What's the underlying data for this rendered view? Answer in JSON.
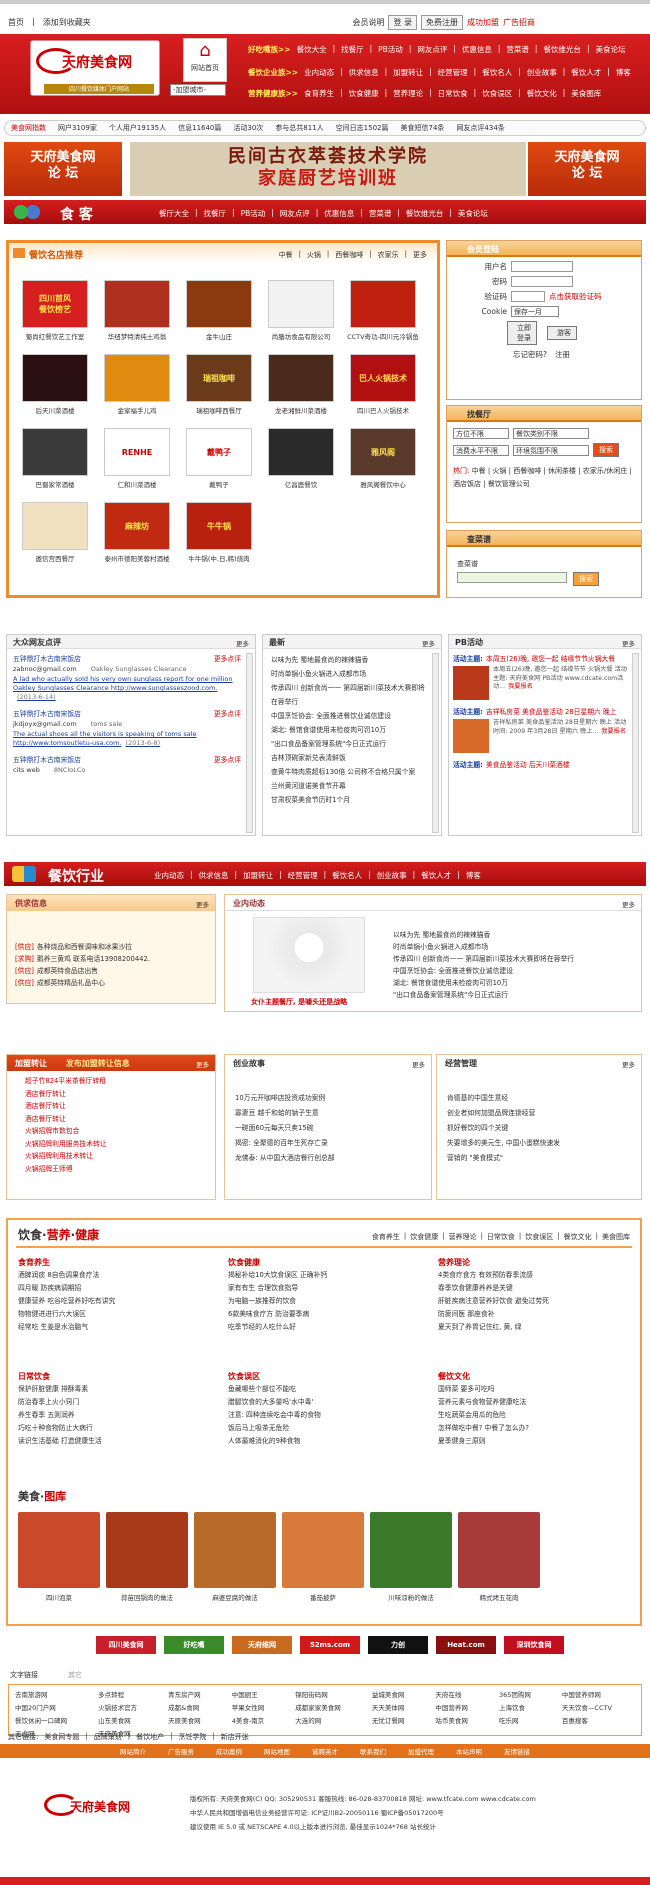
{
  "topbar": {
    "home": "首页",
    "favorite": "添加到收藏夹",
    "help": "会员说明",
    "login": "登 录",
    "register": "免费注册",
    "join": "成功加盟",
    "ads": "广告招商"
  },
  "header": {
    "logo": "天府美食网",
    "slogan": "四川餐饮媒体门户网站",
    "site_home": "网站首页",
    "city_select": "-加盟城市-",
    "row1_label": "好吃嘴族>>",
    "row1": [
      "餐饮大全",
      "找餐厅",
      "PB活动",
      "网友点评",
      "优惠信息",
      "营菜谱",
      "餐饮维光台",
      "美食论坛"
    ],
    "row2_label": "餐饮企业族>>",
    "row2": [
      "业内动态",
      "供求信息",
      "加盟转让",
      "经营管理",
      "餐饮名人",
      "创业故事",
      "餐饮人才",
      "博客"
    ],
    "row3_label": "营养健康族>>",
    "row3": [
      "食育养生",
      "饮食健康",
      "营养理论",
      "日常饮食",
      "饮食误区",
      "餐饮文化",
      "美食图库"
    ]
  },
  "stats": {
    "label": "美食网指数",
    "items": [
      "网户3109家",
      "个人用户19135人",
      "信息11640篇",
      "活动30次",
      "参与总共811人",
      "空间日志1502篇",
      "美食短信74条",
      "网友点评434条"
    ]
  },
  "banner": {
    "left": "天府美食网\n论 坛",
    "mid1": "民间古衣萃荟技术学院",
    "mid2": "家庭厨艺培训班",
    "right": "天府美食网\n论 坛"
  },
  "catband": {
    "title": "食 客",
    "links": [
      "餐厅大全",
      "找餐厅",
      "PB活动",
      "网友点评",
      "优惠信息",
      "营菜谱",
      "餐饮维光台",
      "美食论坛"
    ]
  },
  "restaurants": {
    "title": "餐饮名店推荐",
    "tabs": [
      "中餐",
      "火锅",
      "西餐咖啡",
      "农家乐",
      "更多"
    ],
    "items": [
      {
        "name": "蜀尚红餐饮艺工作室",
        "color": "#d62020",
        "sub": "四川首风\n餐饮榜艺"
      },
      {
        "name": "华纽梦特清纯土鸡翁",
        "color": "#b03020",
        "sub": ""
      },
      {
        "name": "金牛山庄",
        "color": "#8b3a10",
        "sub": ""
      },
      {
        "name": "尚膳坊食品有限公司",
        "color": "#f2f2f2",
        "sub": ""
      },
      {
        "name": "CCTV奇功-四川元冷锅鱼",
        "color": "#c02010",
        "sub": ""
      },
      {
        "name": "后天川菜酒楼",
        "color": "#2a1010",
        "sub": ""
      },
      {
        "name": "金家福手儿鸡",
        "color": "#e08a10",
        "sub": ""
      },
      {
        "name": "瑞祖咖啡西餐厅",
        "color": "#6a3a1a",
        "sub": "瑞祖咖啡"
      },
      {
        "name": "龙老湘鲜川菜酒楼",
        "color": "#4a2a1a",
        "sub": ""
      },
      {
        "name": "四川巴人火锅技术",
        "color": "#b01010",
        "sub": "巴人火锅技术"
      },
      {
        "name": "巴蜀家常酒楼",
        "color": "#3a3a3a",
        "sub": ""
      },
      {
        "name": "仁和川菜酒楼",
        "color": "#ffffff",
        "sub": "RENHE"
      },
      {
        "name": "戴鸭子",
        "color": "#ffffff",
        "sub": "戴鸭子"
      },
      {
        "name": "亿昌鹿餐饮",
        "color": "#2a2a2a",
        "sub": ""
      },
      {
        "name": "雅风阁餐饮中心",
        "color": "#5a3a2a",
        "sub": "雅风阁"
      },
      {
        "name": "邀信宫西餐厅",
        "color": "#f0e0c0",
        "sub": ""
      },
      {
        "name": "泰州市德阳美蓉村酒楼",
        "color": "#c02a10",
        "sub": "麻辣坊"
      },
      {
        "name": "牛牛锅(中,日,韩)烧肉",
        "color": "#b82010",
        "sub": "牛牛锅"
      }
    ]
  },
  "login": {
    "title": "会员登陆",
    "user": "用户名",
    "pass": "密码",
    "code": "验证码",
    "code_link": "点击获取验证码",
    "cookie": "Cookie",
    "cookie_val": "保存一月",
    "login_btn": "立即登录",
    "register_btn": "游客",
    "forget": "忘记密码?",
    "reg": "注册"
  },
  "finder": {
    "title": "找餐厅",
    "s1": "方位不限",
    "s2": "餐饮类别不限",
    "s3": "消费水平不限",
    "s4": "环境氛围不限",
    "search": "搜索",
    "hot_label": "热门:",
    "hot": [
      "中餐",
      "火锅",
      "西餐咖啡",
      "休闲茶楼",
      "农家乐/休闲庄",
      "酒店饭店",
      "餐饮管理公司"
    ]
  },
  "recipe": {
    "title": "查菜谱",
    "label": "查菜谱",
    "btn": "搜索"
  },
  "reviews": {
    "title": "大众网友点评",
    "more": "更多",
    "items": [
      {
        "shop": "五钟鼎打木古南宋饭店",
        "user": "zabnoc@gmail.com",
        "topic": "Oakley Sunglasses Clearance",
        "content": "A lad who actually sold his very own sunglass report for one million Oakley Sunglasses Clearance http://www.sunglasseszood.com.",
        "date": "(2013-6-14)"
      },
      {
        "shop": "五钟鼎打木古南宋饭店",
        "user": "jkdjoyx@gmail.com",
        "topic": "toms sale",
        "content": "The actual shoes all the visitors is speaking of toms sale http://www.tomsoutletu-usa.com.",
        "date": "(2013-6-8)"
      },
      {
        "shop": "五钟鼎打木古南宋饭店",
        "user": "cits web",
        "topic": "8NCIoLCo",
        "content": "",
        "date": ""
      }
    ],
    "more_label": "更多点评"
  },
  "latest": {
    "title": "最新",
    "more": "更多",
    "items": [
      "以味为先 蜀地最食尚的辣辣猫香",
      "时尚单锅小鱼火锅进入成都市场",
      "传承四川 创新食尚一一 第四届新川菜技术大赛即将在蓉举行",
      "中国烹饪协会: 全面推进餐饮业诚信建设",
      "湖北: 餐馆食谱使用未检疫肉可罚10万",
      "\"出口食品备案管理系统\"今日正式运行",
      "吉林顶碗家新兑表清鲜饭",
      "查黄牛特肉质超标130倍 公司称不合格只属个案",
      "兰州黄河道诺美食节开幕",
      "甘肃权菜美食节历时1个月"
    ]
  },
  "pb": {
    "title": "PB活动",
    "more": "更多",
    "items": [
      {
        "head": "活动主题:",
        "title": "本周五(26)晚, 邀您一起 结缘节节火锅大餐",
        "text": "本周五(26)晚, 邀您一起 结缘节节 火锅大餐 活动主题: 天府美食网 PB活动 www.cdcate.com活动...",
        "link": "我要报名"
      },
      {
        "head": "活动主题:",
        "title": "吉祥私房菜 美食品鉴活动 28日星期六 晚上",
        "text": "吉祥私房菜 美食品鉴活动 28日星期六 晚上 活动时间: 2009 年3月28日 星期六 晚上...",
        "link": "我要报名"
      },
      {
        "head": "活动主题:",
        "title": "美食品鉴活动 后天川菜酒楼",
        "text": "",
        "link": ""
      }
    ]
  },
  "industry": {
    "title": "餐饮行业",
    "links": [
      "业内动态",
      "供求信息",
      "加盟转让",
      "经营管理",
      "餐饮名人",
      "创业故事",
      "餐饮人才",
      "博客"
    ]
  },
  "supply": {
    "title": "供求信息",
    "more": "更多",
    "items": [
      {
        "tag": "[供应]",
        "text": "各种烧品和西餐调味和冰果沙拉"
      },
      {
        "tag": "[求购]",
        "text": "鹅养三黄鸡 联系电话13908200442."
      },
      {
        "tag": "[供应]",
        "text": "成都英特食品店出售"
      },
      {
        "tag": "[供应]",
        "text": "成都英特精品礼品中心"
      }
    ]
  },
  "news": {
    "title": "业内动态",
    "more": "更多",
    "caption": "女仆主题餐厅, 是噱头还是战略",
    "items": [
      "以味为先 蜀地最食尚的辣辣猫香",
      "时尚单锅小鱼火锅进入成都市场",
      "传承四川 创新食尚一一 第四届新川菜技术大赛即将在蓉举行",
      "中国烹饪协会: 全面推进餐饮业诚信建设",
      "湖北: 餐馆食谱使用未检疫肉可罚10万",
      "\"出口食品备案管理系统\"今日正式运行"
    ]
  },
  "transfer": {
    "title": "加盟转让",
    "sub": "发布加盟转让信息",
    "more": "更多",
    "items": [
      "超子竹824平米茶餐厅转租",
      "酒店餐厅转让",
      "酒店餐厅转让",
      "酒店餐厅转让",
      "火锅招牌市数包合",
      "火锅招牌利用服务技术转让",
      "火锅招牌利用技术转让",
      "火锅招牌王师傅"
    ]
  },
  "story": {
    "title": "创业故事",
    "more": "更多",
    "items": [
      "10万元开咖啡店投资成功案例",
      "寡妻豆 越千和蛤的钠子生意",
      "一碗面60元每天只卖15碗",
      "揭密: 全聚德的百年生死存亡录",
      "龙佛泰: 从中国大酒店餐行创总部"
    ]
  },
  "mgmt": {
    "title": "经营管理",
    "more": "更多",
    "items": [
      "肯德基的中国生意经",
      "创业者如何加盟品牌连锁经营",
      "抓好餐饮的四个关键",
      "失要增多的美元生, 中国小蛋糕快速发",
      "营销的 \"美食模式\""
    ]
  },
  "food": {
    "title1": "饮食",
    "title2": "营养",
    "title3": "健康",
    "nav": [
      "食育养生",
      "饮食健康",
      "营养理论",
      "日常饮食",
      "饮食误区",
      "餐饮文化",
      "美食图库"
    ],
    "cols": [
      {
        "title": "食育养生",
        "items": [
          "酒脾润痰 8自色调果食疗法",
          "四月暖 防疾病调期招",
          "健康营养 吃谷吃营养好吃有讲究",
          "物物健进进行六大误区",
          "经常吃 生姜是水治脑气"
        ]
      },
      {
        "title": "饮食健康",
        "items": [
          "揭秘补给10大饮食误区 正确补钙",
          "家有有生 合理饮食指导",
          "为电脑一族推荐的饮食",
          "6款美味食疗方 防治要季病",
          "吃季节经的人吃什么好"
        ]
      },
      {
        "title": "营养理论",
        "items": [
          "4类食疗食方 有效预防春季流感",
          "春季饮食健康养养是关键",
          "肝脏疾病注意营养好饮食 避免过劳死",
          "防疲间医 那座食补",
          "夏天到了养胃记住红, 黄, 绿"
        ]
      },
      {
        "title": "日常饮食",
        "items": [
          "保护肝脏健康 排酥毒素",
          "防治春季上火小窍门",
          "养生春季 五则润养",
          "巧吃十种食物防止大病行",
          "读识生活基础 打造健康生活"
        ]
      },
      {
        "title": "饮食误区",
        "items": [
          "鱼藏哪些个部位不能吃",
          "腊腿饮食的大多量吗'水中毒'",
          "注意: 四种连续吃会中毒的食物",
          "饭后马上吸茶无危险",
          "人体最难消化的9种食物"
        ]
      },
      {
        "title": "餐饮文化",
        "items": [
          "国师菜 要多可吃吗",
          "营养元素与食物营养健康吃法",
          "生吃蔬菜会用瓜的危险",
          "怎样做吃中餐? 中餐了怎么办?",
          "夏季健身三原则"
        ]
      }
    ],
    "gallery_title1": "美食",
    "gallery_title2": "图库",
    "gallery": [
      {
        "name": "四川泡菜",
        "color": "#c84a2a"
      },
      {
        "name": "蒜苗回锅肉的做法",
        "color": "#a83a1a"
      },
      {
        "name": "麻婆豆腐的做法",
        "color": "#b86a2a"
      },
      {
        "name": "番茄披萨",
        "color": "#d87a3a"
      },
      {
        "name": "川味凉粉的做法",
        "color": "#3a7a2a"
      },
      {
        "name": "韩式烤五花肉",
        "color": "#a83a3a"
      }
    ]
  },
  "partners": [
    {
      "name": "四川美食网",
      "color": "#c8202a"
    },
    {
      "name": "好吃嘴",
      "color": "#3a8a2a"
    },
    {
      "name": "天府维网",
      "color": "#c86a20"
    },
    {
      "name": "52ms.com",
      "color": "#d01a1a"
    },
    {
      "name": "力创",
      "color": "#111111"
    },
    {
      "name": "Heat.com",
      "color": "#8a1010"
    },
    {
      "name": "深圳饮食网",
      "color": "#c01020"
    }
  ],
  "links": {
    "tab1": "文字链接",
    "tab2": "其它",
    "items": [
      "去南旅游网",
      "多点转程",
      "青东房产网",
      "中国厨王",
      "锦阳街码网",
      "益城美食网",
      "天府在线",
      "365团购网",
      "中国营养师网",
      "中国20门户网",
      "火锅技术官方",
      "成都&食网",
      "苹果女性网",
      "成都家家美食网",
      "天天美体网",
      "中国营养网",
      "上海饮食",
      "天天饮食—CCTV",
      "餐饮休闲一口碑网",
      "山东美食网",
      "天原美食网",
      "4美食-南京",
      "大连的网",
      "无忧订餐网",
      "咕币美食网",
      "吃乐网",
      "百惠搜客",
      "无虑网",
      "天府美食网"
    ]
  },
  "other": {
    "label": "其它链接:",
    "items": [
      "美食网专题",
      "品牌策划",
      "餐饮地产",
      "烹饪学院",
      "新店开张"
    ]
  },
  "footnav": [
    "网站简介",
    "广告服务",
    "成功案例",
    "网站地图",
    "诚聘英才",
    "联系我们",
    "加盟代理",
    "本站声明",
    "友情链接"
  ],
  "footer": {
    "logo": "天府美食网",
    "l1": "版权所有: 天府美食网(C)  QQ: 305290531  客服热线: 86-028-83700818  网址: www.tfcate.com  www.cdcate.com",
    "l2": "中华人民共和国增值电信业务经营许可证: ICP证川B2-20050116  蜀ICP备05017200号",
    "l3": "建议使用 IE 5.0 或 NETSCAPE 4.0以上版本进行浏览, 最佳显示1024*768 站长统计"
  },
  "colors": {
    "red": "#d51e1e",
    "orange": "#f08a2a",
    "brown": "#d45500"
  }
}
